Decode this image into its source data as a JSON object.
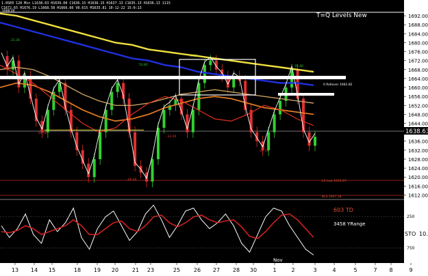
{
  "header": {
    "info_text": "1.0SE0 120 Min L1638.63 H1639.00 C1636.15 H1636.15 H1637.13 C1635.13 H1636.13 1115",
    "info_text_2": "C1672.65 H1676.19 L1668.58 H1666.66 V8.615 M1635.81 10-12-22 15:0:13"
  },
  "annotations": {
    "title": "T=Q Levels New",
    "rollover": "0 Rollover 1662.82",
    "low": "LS Low 1614.97",
    "bls": "BLS 1607.18",
    "td": "603 TD",
    "yrange": "3458 YRange",
    "sto": "STO",
    "sto_value": "10.",
    "osc_upper": "250",
    "osc_lower": "750",
    "pt1": "21.30",
    "pt2": "53.82",
    "pt3": "38.59",
    "pt4": "35.40",
    "pt5": "-34.36",
    "pt6": "-32.09",
    "pt7": "-42.49",
    "pt8": "-48.88",
    "nov": "Nov",
    "top_marker": "1688.00"
  },
  "colors": {
    "background": "#000000",
    "axis_bg": "#ffffff",
    "ma_yellow": "#f0e040",
    "ma_blue": "#2030e0",
    "ma_orange": "#e07a20",
    "ma_red": "#e03020",
    "ma_tan": "#c8a060",
    "ma_white": "#ffffff",
    "candle_green": "#30d030",
    "candle_red": "#e03030",
    "price_tag": "#000000"
  },
  "chart_data": {
    "type": "line",
    "price_axis": {
      "ticks": [
        1612,
        1616,
        1620,
        1624,
        1628,
        1632,
        1636,
        1640,
        1644,
        1648,
        1652,
        1656,
        1660,
        1664,
        1668,
        1672,
        1676,
        1680,
        1684,
        1688,
        1692
      ],
      "current_price": "1638.63",
      "range": [
        1610,
        1696
      ]
    },
    "x_axis": {
      "labels": [
        "13",
        "14",
        "15",
        "18",
        "19",
        "20",
        "21",
        "23",
        "25",
        "26",
        "27",
        "28",
        "30",
        "1",
        "2",
        "3",
        "4",
        "5",
        "7",
        "8",
        "9"
      ]
    },
    "series": [
      {
        "name": "price",
        "values": [
          1674,
          1668,
          1672,
          1660,
          1665,
          1655,
          1645,
          1640,
          1650,
          1658,
          1662,
          1650,
          1640,
          1632,
          1626,
          1620,
          1628,
          1640,
          1650,
          1658,
          1662,
          1655,
          1640,
          1625,
          1622,
          1618,
          1628,
          1642,
          1650,
          1652,
          1655,
          1648,
          1640,
          1650,
          1662,
          1670,
          1672,
          1668,
          1665,
          1660,
          1665,
          1663,
          1650,
          1640,
          1636,
          1632,
          1640,
          1648,
          1654,
          1660,
          1668,
          1655,
          1640,
          1634,
          1638
        ]
      },
      {
        "name": "ma_yellow",
        "values": [
          1693,
          1692,
          1690,
          1688,
          1686,
          1684,
          1682,
          1680,
          1679,
          1677,
          1676,
          1675,
          1674,
          1673,
          1672,
          1671,
          1670,
          1669,
          1668,
          1667
        ]
      },
      {
        "name": "ma_blue",
        "values": [
          1689,
          1687,
          1685,
          1683,
          1681,
          1679,
          1677,
          1675,
          1673,
          1672,
          1670,
          1669,
          1667,
          1666,
          1665,
          1664,
          1663,
          1662,
          1662,
          1661
        ]
      },
      {
        "name": "ma_orange",
        "values": [
          1660,
          1662,
          1661,
          1658,
          1654,
          1650,
          1647,
          1645,
          1646,
          1648,
          1651,
          1653,
          1655,
          1656,
          1655,
          1653,
          1651,
          1650,
          1649,
          1648
        ]
      },
      {
        "name": "ma_tan",
        "values": [
          1668,
          1669,
          1668,
          1665,
          1661,
          1657,
          1654,
          1652,
          1652,
          1653,
          1655,
          1657,
          1658,
          1659,
          1658,
          1657,
          1656,
          1655,
          1654,
          1653
        ]
      },
      {
        "name": "ma_red_fast",
        "values": [
          1670,
          1666,
          1662,
          1656,
          1650,
          1644,
          1640,
          1642,
          1648,
          1653,
          1656,
          1654,
          1650,
          1646,
          1645,
          1648,
          1652,
          1650,
          1646,
          1643
        ]
      }
    ],
    "oscillator": {
      "name": "STO",
      "upper": 250,
      "lower": 750,
      "white": [
        60,
        40,
        55,
        80,
        45,
        30,
        70,
        50,
        65,
        90,
        40,
        20,
        55,
        75,
        85,
        60,
        35,
        50,
        80,
        95,
        70,
        40,
        60,
        85,
        90,
        70,
        55,
        65,
        80,
        60,
        30,
        15,
        45,
        75,
        90,
        85,
        60,
        40,
        20,
        10
      ],
      "red": [
        50,
        48,
        52,
        60,
        55,
        45,
        50,
        55,
        60,
        70,
        60,
        45,
        45,
        55,
        65,
        68,
        55,
        50,
        60,
        75,
        78,
        65,
        58,
        65,
        75,
        78,
        70,
        65,
        68,
        70,
        58,
        42,
        38,
        50,
        65,
        78,
        80,
        70,
        55,
        40
      ]
    },
    "levels": [
      {
        "name": "top_line",
        "value": 1696
      },
      {
        "name": "white_bar_1",
        "value": 1666
      },
      {
        "name": "white_bar_2",
        "value": 1657
      },
      {
        "name": "ls_low",
        "value": 1614.97
      },
      {
        "name": "bls",
        "value": 1607.18
      },
      {
        "name": "gray_line",
        "value": 1638.6
      }
    ]
  }
}
